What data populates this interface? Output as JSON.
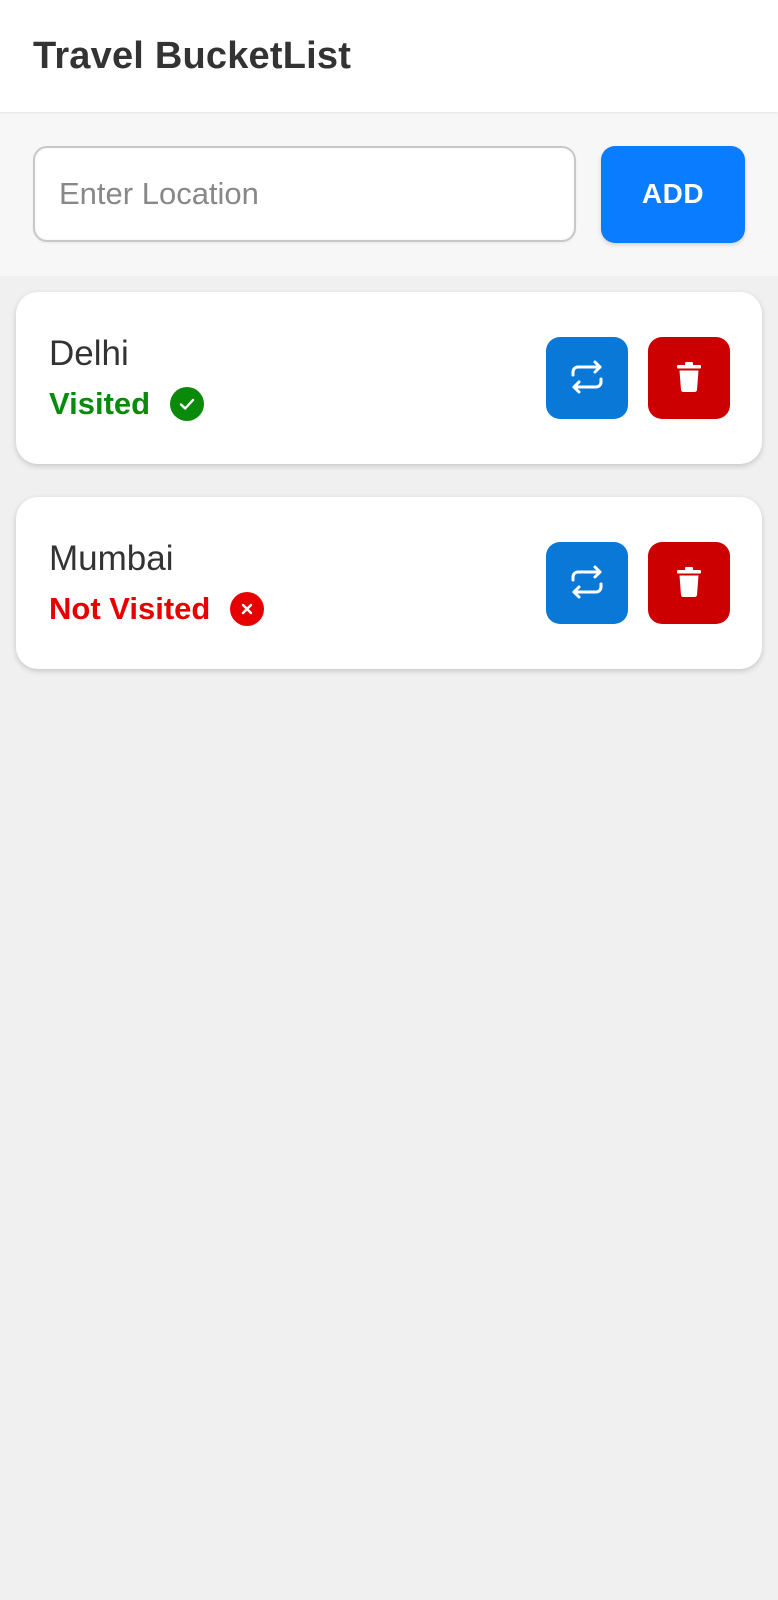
{
  "header": {
    "title": "Travel BucketList"
  },
  "add_form": {
    "input_value": "",
    "input_placeholder": "Enter Location",
    "add_label": "ADD"
  },
  "colors": {
    "accent": "#0a7cff",
    "toggle": "#0a78d7",
    "delete": "#cc0000",
    "visited": "#0a8a0a",
    "not_visited": "#e60000"
  },
  "items": [
    {
      "name": "Delhi",
      "status": "Visited",
      "visited": true,
      "status_icon": "check-circle-icon",
      "toggle_icon": "repeat-icon",
      "delete_icon": "trash-icon"
    },
    {
      "name": "Mumbai",
      "status": "Not Visited",
      "visited": false,
      "status_icon": "x-circle-icon",
      "toggle_icon": "repeat-icon",
      "delete_icon": "trash-icon"
    }
  ]
}
